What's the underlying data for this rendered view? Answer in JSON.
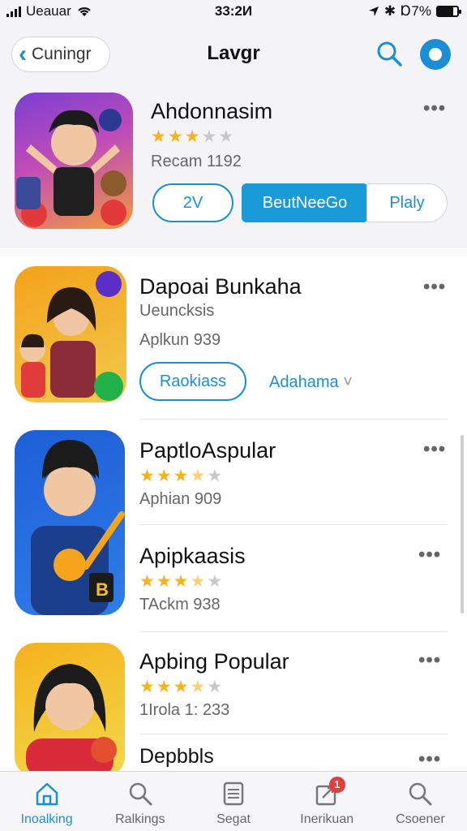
{
  "status_bar": {
    "carrier": "Ueauar",
    "time": "33:2И",
    "battery": "Ɒ7%"
  },
  "header": {
    "back_label": "Cuningr",
    "title": "Lavgr"
  },
  "featured": {
    "name": "Ahdonnasim",
    "rating": 3,
    "meta": "Recam 1192",
    "buttons": [
      "2V",
      "BeutNeeGo",
      "Plaly"
    ]
  },
  "apps": [
    {
      "name": "Dapoai Bunkaha",
      "subtitle": "Ueuncksis",
      "meta": "Aplkun 939",
      "primary_button": "Raokiass",
      "link": "Adahama"
    },
    {
      "name": "PaptloAspular",
      "rating": 3.5,
      "meta": "Aphian 909"
    },
    {
      "name": "Apipkaasis",
      "rating": 3.5,
      "meta": "TAckm 938"
    },
    {
      "name": "Apbing Popular",
      "rating": 3.5,
      "meta": "1Irola 1: 233"
    },
    {
      "name": "Depbbls"
    }
  ],
  "tabs": [
    {
      "label": "Inoalking",
      "icon": "home-icon",
      "active": true
    },
    {
      "label": "Ralkings",
      "icon": "search-icon"
    },
    {
      "label": "Segat",
      "icon": "list-icon"
    },
    {
      "label": "Inerikuan",
      "icon": "update-icon",
      "badge": "1"
    },
    {
      "label": "Csoener",
      "icon": "search-icon"
    }
  ],
  "colors": {
    "accent": "#1b8fd6",
    "star": "#f5b21c",
    "badge": "#e43b3b"
  }
}
